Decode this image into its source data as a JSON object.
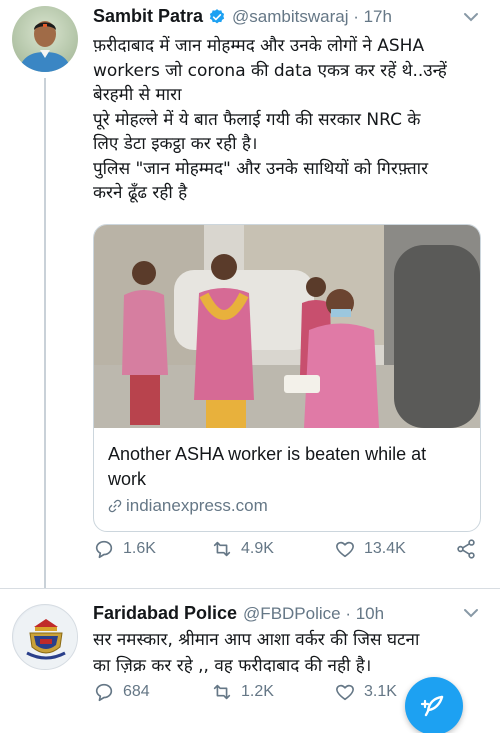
{
  "tweet1": {
    "name": "Sambit Patra",
    "handle": "@sambitswaraj · 17h",
    "avatar_icon": "person-avatar",
    "verified_icon": "verified-badge-icon",
    "text_lines": [
      "फ़रीदाबाद में जान मोहम्मद और उनके लोगों ने ASHA",
      "workers जो corona की data एकत्र कर रहें थे..उन्हें",
      "बेरहमी से मारा",
      "पूरे मोहल्ले में ये बात फैलाई गयी की सरकार NRC के",
      "लिए डेटा इकट्ठा कर रही है।",
      "पुलिस \"जान मोहम्मद\" और उनके साथियों को गिरफ़्तार",
      "करने ढूँढ रही है"
    ],
    "card": {
      "image_icon": "asha-workers-photo",
      "title": "Another ASHA worker is beaten while at work",
      "domain": "indianexpress.com"
    },
    "actions": {
      "replies": "1.6K",
      "retweets": "4.9K",
      "likes": "13.4K"
    }
  },
  "tweet2": {
    "name": "Faridabad Police",
    "handle": "@FBDPolice · 10h",
    "avatar_icon": "police-emblem",
    "text_lines": [
      "सर नमस्कार, श्रीमान आप आशा वर्कर की जिस घटना",
      "का ज़िक्र कर रहे ,, वह फरीदाबाद की नही है।"
    ],
    "actions": {
      "replies": "684",
      "retweets": "1.2K",
      "likes": "3.1K"
    }
  },
  "colors": {
    "accent": "#1da1f2",
    "secondary_text": "#657786",
    "primary_text": "#14171a"
  }
}
